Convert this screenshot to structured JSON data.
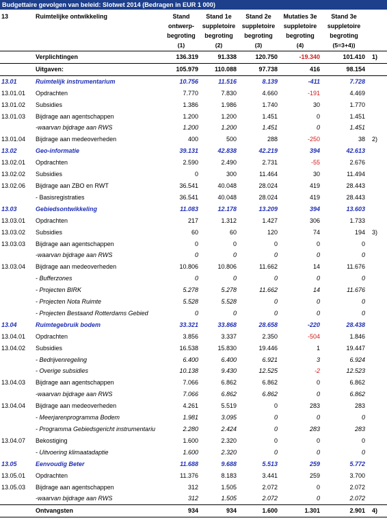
{
  "title": "Budgettaire gevolgen van beleid: Slotwet 2014 (Bedragen in EUR 1 000)",
  "header": {
    "chapter": "13",
    "subject": "Ruimtelijke ontwikkeling",
    "col1": [
      "Stand",
      "ontwerp-",
      "begroting",
      "(1)"
    ],
    "col2": [
      "Stand 1e",
      "suppletoire",
      "begroting",
      "(2)"
    ],
    "col3": [
      "Stand 2e",
      "suppletoire",
      "begroting",
      "(3)"
    ],
    "col4": [
      "Mutaties 3e",
      "suppletoire",
      "begroting",
      "(4)"
    ],
    "col5": [
      "Stand 3e",
      "suppletoire",
      "begroting",
      "(5=3+4))"
    ]
  },
  "rows": [
    {
      "code": "",
      "label": "Verplichtingen",
      "v": [
        "136.319",
        "91.338",
        "120.750",
        "-19.340",
        "101.410"
      ],
      "note": "1)",
      "type": "bold topline"
    },
    {
      "code": "",
      "label": "Uitgaven:",
      "v": [
        "105.979",
        "110.088",
        "97.738",
        "416",
        "98.154"
      ],
      "note": "",
      "type": "bold topline botline"
    },
    {
      "code": "13.01",
      "label": "Ruimtelijk instrumentarium",
      "v": [
        "10.756",
        "11.516",
        "8.139",
        "-411",
        "7.728"
      ],
      "note": "",
      "type": "section"
    },
    {
      "code": "13.01.01",
      "label": "Opdrachten",
      "v": [
        "7.770",
        "7.830",
        "4.660",
        "-191",
        "4.469"
      ],
      "note": "",
      "type": ""
    },
    {
      "code": "13.01.02",
      "label": "Subsidies",
      "v": [
        "1.386",
        "1.986",
        "1.740",
        "30",
        "1.770"
      ],
      "note": "",
      "type": ""
    },
    {
      "code": "13.01.03",
      "label": "Bijdrage aan agentschappen",
      "v": [
        "1.200",
        "1.200",
        "1.451",
        "0",
        "1.451"
      ],
      "note": "",
      "type": ""
    },
    {
      "code": "",
      "label": "-waarvan bijdrage aan RWS",
      "v": [
        "1.200",
        "1.200",
        "1.451",
        "0",
        "1.451"
      ],
      "note": "",
      "type": "it"
    },
    {
      "code": "13.01.04",
      "label": "Bijdrage aan medeoverheden",
      "v": [
        "400",
        "500",
        "288",
        "-250",
        "38"
      ],
      "note": "2)",
      "type": ""
    },
    {
      "code": "13.02",
      "label": "Geo-informatie",
      "v": [
        "39.131",
        "42.838",
        "42.219",
        "394",
        "42.613"
      ],
      "note": "",
      "type": "section"
    },
    {
      "code": "13.02.01",
      "label": "Opdrachten",
      "v": [
        "2.590",
        "2.490",
        "2.731",
        "-55",
        "2.676"
      ],
      "note": "",
      "type": ""
    },
    {
      "code": "13.02.02",
      "label": "Subsidies",
      "v": [
        "0",
        "300",
        "11.464",
        "30",
        "11.494"
      ],
      "note": "",
      "type": ""
    },
    {
      "code": "13.02.06",
      "label": "Bijdrage aan ZBO en RWT",
      "v": [
        "36.541",
        "40.048",
        "28.024",
        "419",
        "28.443"
      ],
      "note": "",
      "type": ""
    },
    {
      "code": "",
      "label": " - Basisregistraties",
      "v": [
        "36.541",
        "40.048",
        "28.024",
        "419",
        "28.443"
      ],
      "note": "",
      "type": ""
    },
    {
      "code": "13.03",
      "label": "Gebiedsontwikkeling",
      "v": [
        "11.083",
        "12.178",
        "13.209",
        "394",
        "13.603"
      ],
      "note": "",
      "type": "section"
    },
    {
      "code": "13.03.01",
      "label": "Opdrachten",
      "v": [
        "217",
        "1.312",
        "1.427",
        "306",
        "1.733"
      ],
      "note": "",
      "type": ""
    },
    {
      "code": "13.03.02",
      "label": "Subsidies",
      "v": [
        "60",
        "60",
        "120",
        "74",
        "194"
      ],
      "note": "3)",
      "type": ""
    },
    {
      "code": "13.03.03",
      "label": "Bijdrage aan agentschappen",
      "v": [
        "0",
        "0",
        "0",
        "0",
        "0"
      ],
      "note": "",
      "type": ""
    },
    {
      "code": "",
      "label": "-waarvan bijdrage aan RWS",
      "v": [
        "0",
        "0",
        "0",
        "0",
        "0"
      ],
      "note": "",
      "type": "it"
    },
    {
      "code": "13.03.04",
      "label": "Bijdrage aan medeoverheden",
      "v": [
        "10.806",
        "10.806",
        "11.662",
        "14",
        "11.676"
      ],
      "note": "",
      "type": ""
    },
    {
      "code": "",
      "label": " - Bufferzones",
      "v": [
        "0",
        "0",
        "0",
        "0",
        "0"
      ],
      "note": "",
      "type": "it"
    },
    {
      "code": "",
      "label": " - Projecten BIRK",
      "v": [
        "5.278",
        "5.278",
        "11.662",
        "14",
        "11.676"
      ],
      "note": "",
      "type": "it"
    },
    {
      "code": "",
      "label": " - Projecten Nota Ruimte",
      "v": [
        "5.528",
        "5.528",
        "0",
        "0",
        "0"
      ],
      "note": "",
      "type": "it"
    },
    {
      "code": "",
      "label": " - Projecten Bestaand Rotterdams Gebied",
      "v": [
        "0",
        "0",
        "0",
        "0",
        "0"
      ],
      "note": "",
      "type": "it"
    },
    {
      "code": "13.04",
      "label": "Ruimtegebruik bodem",
      "v": [
        "33.321",
        "33.868",
        "28.658",
        "-220",
        "28.438"
      ],
      "note": "",
      "type": "section"
    },
    {
      "code": "13.04.01",
      "label": "Opdrachten",
      "v": [
        "3.856",
        "3.337",
        "2.350",
        "-504",
        "1.846"
      ],
      "note": "",
      "type": ""
    },
    {
      "code": "13.04.02",
      "label": "Subsidies",
      "v": [
        "16.538",
        "15.830",
        "19.446",
        "1",
        "19.447"
      ],
      "note": "",
      "type": ""
    },
    {
      "code": "",
      "label": " - Bedrijvenregeling",
      "v": [
        "6.400",
        "6.400",
        "6.921",
        "3",
        "6.924"
      ],
      "note": "",
      "type": "it"
    },
    {
      "code": "",
      "label": " - Overige subsidies",
      "v": [
        "10.138",
        "9.430",
        "12.525",
        "-2",
        "12.523"
      ],
      "note": "",
      "type": "it"
    },
    {
      "code": "13.04.03",
      "label": "Bijdrage aan agentschappen",
      "v": [
        "7.066",
        "6.862",
        "6.862",
        "0",
        "6.862"
      ],
      "note": "",
      "type": ""
    },
    {
      "code": "",
      "label": "-waarvan bijdrage aan RWS",
      "v": [
        "7.066",
        "6.862",
        "6.862",
        "0",
        "6.862"
      ],
      "note": "",
      "type": "it"
    },
    {
      "code": "13.04.04",
      "label": "Bijdrage aan medeoverheden",
      "v": [
        "4.261",
        "5.519",
        "0",
        "283",
        "283"
      ],
      "note": "",
      "type": ""
    },
    {
      "code": "",
      "label": " - Meerjarenprogramma Bodem",
      "v": [
        "1.981",
        "3.095",
        "0",
        "0",
        "0"
      ],
      "note": "",
      "type": "it"
    },
    {
      "code": "",
      "label": " - Programma Gebiedsgericht instrumentariu",
      "v": [
        "2.280",
        "2.424",
        "0",
        "283",
        "283"
      ],
      "note": "",
      "type": "it"
    },
    {
      "code": "13.04.07",
      "label": "Bekostiging",
      "v": [
        "1.600",
        "2.320",
        "0",
        "0",
        "0"
      ],
      "note": "",
      "type": ""
    },
    {
      "code": "",
      "label": " - Uitvoering klimaatadaptie",
      "v": [
        "1.600",
        "2.320",
        "0",
        "0",
        "0"
      ],
      "note": "",
      "type": "it"
    },
    {
      "code": "13.05",
      "label": "Eenvoudig Beter",
      "v": [
        "11.688",
        "9.688",
        "5.513",
        "259",
        "5.772"
      ],
      "note": "",
      "type": "section"
    },
    {
      "code": "13.05.01",
      "label": "Opdrachten",
      "v": [
        "11.376",
        "8.183",
        "3.441",
        "259",
        "3.700"
      ],
      "note": "",
      "type": ""
    },
    {
      "code": "13.05.03",
      "label": "Bijdrage aan agentschappen",
      "v": [
        "312",
        "1.505",
        "2.072",
        "0",
        "2.072"
      ],
      "note": "",
      "type": ""
    },
    {
      "code": "",
      "label": "-waarvan bijdrage aan RWS",
      "v": [
        "312",
        "1.505",
        "2.072",
        "0",
        "2.072"
      ],
      "note": "",
      "type": "it"
    },
    {
      "code": "",
      "label": "Ontvangsten",
      "v": [
        "934",
        "934",
        "1.600",
        "1.301",
        "2.901"
      ],
      "note": "4)",
      "type": "bold topline botline"
    }
  ]
}
